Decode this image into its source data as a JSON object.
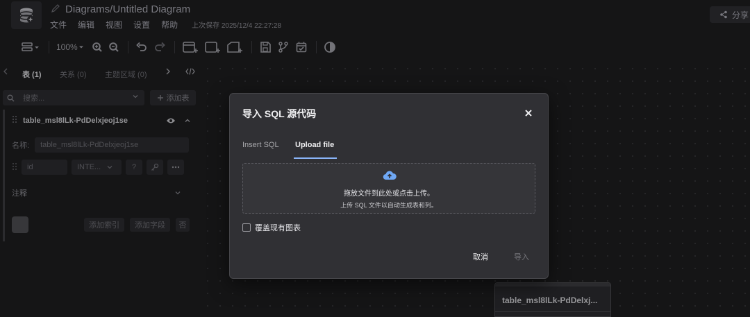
{
  "header": {
    "title": "Diagrams/Untitled Diagram",
    "menus": [
      "文件",
      "编辑",
      "视图",
      "设置",
      "帮助"
    ],
    "last_saved": "上次保存 2025/12/4 22:27:28",
    "share_label": "分享"
  },
  "toolbar": {
    "zoom": "100%"
  },
  "sidebar": {
    "tabs": {
      "tables": "表 (1)",
      "relations": "关系 (0)",
      "areas": "主题区域 (0)"
    },
    "search_placeholder": "搜索...",
    "add_table_label": "添加表",
    "table": {
      "name": "table_msl8lLk-PdDelxjeoj1se",
      "name_label": "名称:",
      "field_name": "id",
      "field_type": "INTE...",
      "field_nullable": "?",
      "comment_label": "注释",
      "add_index_label": "添加索引",
      "add_field_label": "添加字段",
      "delete_label": "否"
    }
  },
  "canvas": {
    "node_title": "table_msl8lLk-PdDelxj..."
  },
  "modal": {
    "title": "导入 SQL 源代码",
    "tabs": [
      "Insert SQL",
      "Upload file"
    ],
    "active_tab": "Upload file",
    "dropzone_text": "拖放文件到此处或点击上传。",
    "dropzone_hint": "上传 SQL 文件以自动生成表和列。",
    "overwrite_label": "覆盖现有图表",
    "overwrite_checked": false,
    "cancel_label": "取消",
    "import_label": "导入"
  },
  "colors": {
    "background": "#1c1c1e",
    "modal_bg": "#303034",
    "accent": "#8ab4f8"
  }
}
